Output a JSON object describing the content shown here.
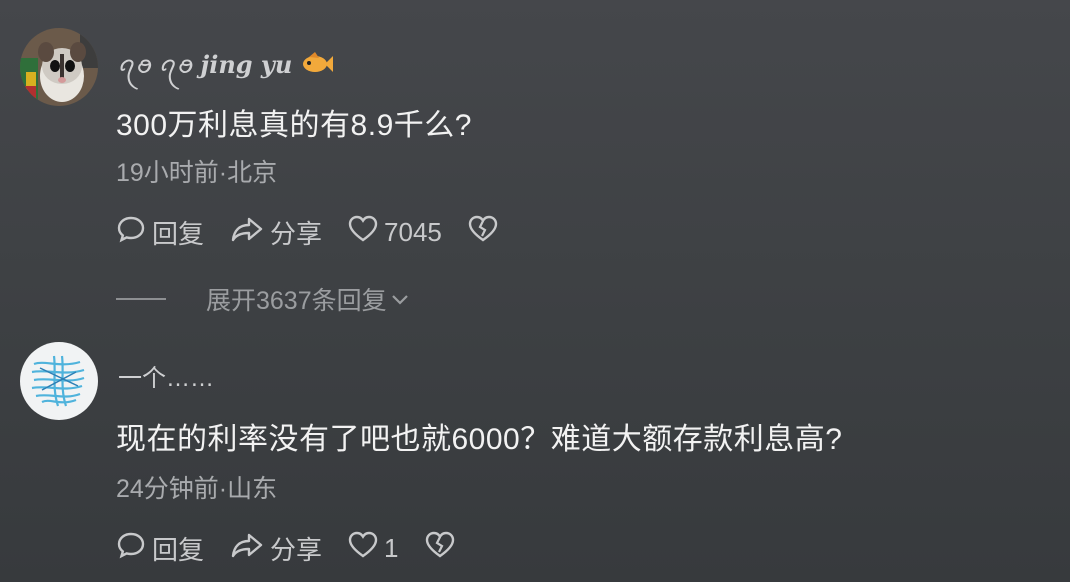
{
  "comments": [
    {
      "nickname_prefix": "ꪖꪮ ꪖꪮ",
      "nickname_main": "jing yu",
      "text": "300万利息真的有8.9千么?",
      "meta": "19小时前·北京",
      "reply_label": "回复",
      "share_label": "分享",
      "likes": "7045",
      "expand_label": "展开3637条回复"
    },
    {
      "nickname_prefix": "",
      "nickname_main": "一个……",
      "text": "现在的利率没有了吧也就6000？难道大额存款利息高?",
      "meta": "24分钟前·山东",
      "reply_label": "回复",
      "share_label": "分享",
      "likes": "1"
    }
  ],
  "icons": {
    "reply": "comment-bubble-icon",
    "share": "share-arrow-icon",
    "like": "heart-icon",
    "dislike": "broken-heart-icon",
    "expand": "chevron-down-icon",
    "fish": "fish-emoji-icon"
  }
}
